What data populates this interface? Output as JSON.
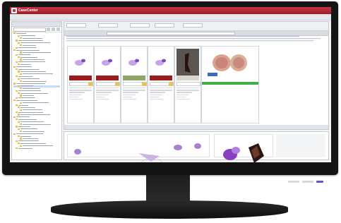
{
  "app": {
    "name": "CaseCenter",
    "subtitle": "",
    "center_title": "",
    "user_items": [
      "",
      ""
    ]
  },
  "breadcrumb": "",
  "tree": {
    "items": [
      {
        "label": ""
      },
      {
        "label": ""
      },
      {
        "label": ""
      },
      {
        "label": ""
      },
      {
        "label": ""
      },
      {
        "label": ""
      },
      {
        "label": ""
      },
      {
        "label": ""
      },
      {
        "label": ""
      },
      {
        "label": ""
      },
      {
        "label": ""
      },
      {
        "label": ""
      },
      {
        "label": ""
      },
      {
        "label": ""
      },
      {
        "label": ""
      },
      {
        "label": ""
      },
      {
        "label": ""
      },
      {
        "label": ""
      },
      {
        "label": ""
      },
      {
        "label": ""
      },
      {
        "label": ""
      },
      {
        "label": ""
      },
      {
        "label": ""
      },
      {
        "label": ""
      },
      {
        "label": ""
      },
      {
        "label": ""
      },
      {
        "label": ""
      },
      {
        "label": ""
      },
      {
        "label": ""
      },
      {
        "label": ""
      },
      {
        "label": ""
      },
      {
        "label": ""
      },
      {
        "label": ""
      },
      {
        "label": ""
      },
      {
        "label": ""
      },
      {
        "label": ""
      },
      {
        "label": ""
      },
      {
        "label": ""
      },
      {
        "label": ""
      },
      {
        "label": ""
      },
      {
        "label": ""
      },
      {
        "label": ""
      },
      {
        "label": ""
      },
      {
        "label": ""
      },
      {
        "label": ""
      },
      {
        "label": ""
      },
      {
        "label": ""
      },
      {
        "label": ""
      },
      {
        "label": ""
      }
    ],
    "selected_index": 22
  },
  "filters": [
    {
      "label": ""
    },
    {
      "label": ""
    },
    {
      "label": ""
    },
    {
      "label": ""
    },
    {
      "label": ""
    }
  ],
  "description": "",
  "thumbnails": [
    {
      "kind": "slide",
      "status_tag": "yellow"
    },
    {
      "kind": "slide",
      "status_tag": "yellow"
    },
    {
      "kind": "slide-label",
      "status_tag": "yellow"
    },
    {
      "kind": "slide",
      "status_tag": "yellow"
    },
    {
      "kind": "dark-photo",
      "status_tag": "none"
    },
    {
      "kind": "specimen-photo",
      "status_tag": "green"
    }
  ],
  "main_footer": "",
  "colors": {
    "brand_red": "#c9323e",
    "status_yellow": "#f2c230",
    "status_green": "#3fae47",
    "tissue_purple": "#9a6cc8"
  },
  "icons": {
    "logo": "app-logo-icon",
    "folder": "folder-icon",
    "search": "search-icon"
  }
}
